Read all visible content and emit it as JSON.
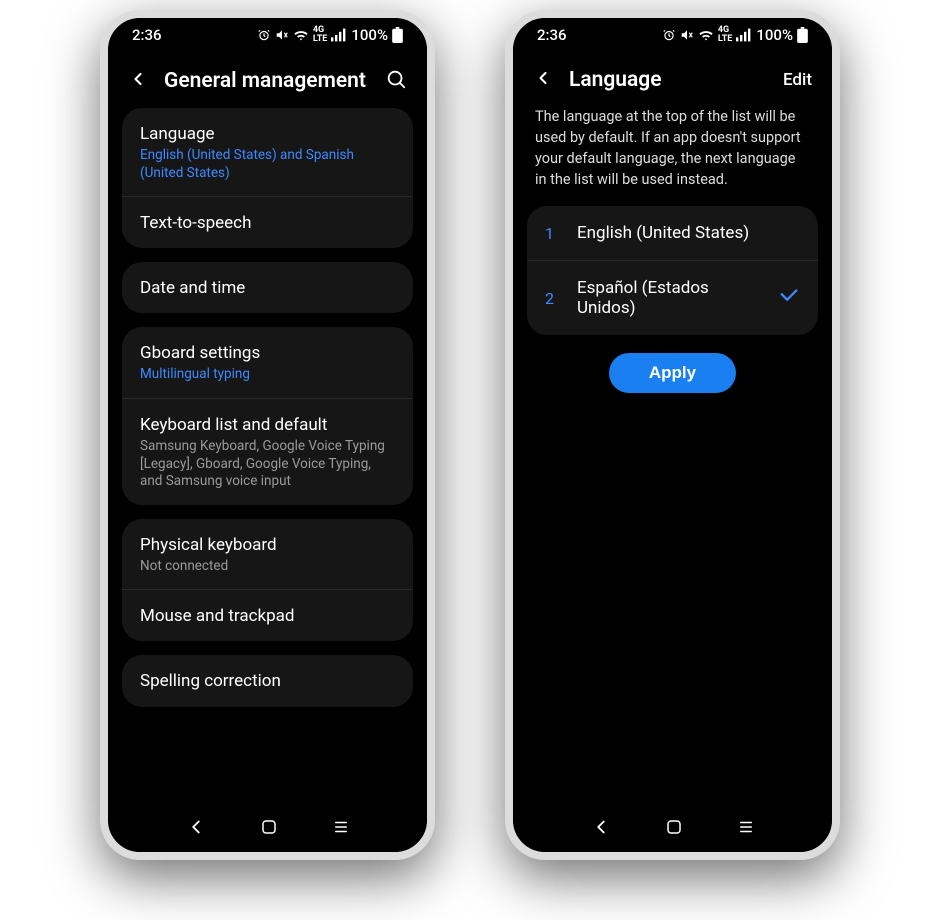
{
  "status": {
    "time": "2:36",
    "battery": "100%"
  },
  "phone1": {
    "title": "General management",
    "groups": [
      {
        "rows": [
          {
            "label": "Language",
            "sub": "English (United States) and Spanish (United States)",
            "accent": true
          },
          {
            "label": "Text-to-speech"
          }
        ]
      },
      {
        "rows": [
          {
            "label": "Date and time"
          }
        ]
      },
      {
        "rows": [
          {
            "label": "Gboard settings",
            "sub": "Multilingual typing",
            "accent": true
          },
          {
            "label": "Keyboard list and default",
            "sub": "Samsung Keyboard, Google Voice Typing [Legacy], Gboard, Google Voice Typing, and Samsung voice input"
          }
        ]
      },
      {
        "rows": [
          {
            "label": "Physical keyboard",
            "sub": "Not connected"
          },
          {
            "label": "Mouse and trackpad"
          }
        ]
      },
      {
        "rows": [
          {
            "label": "Spelling correction"
          }
        ]
      }
    ]
  },
  "phone2": {
    "title": "Language",
    "edit": "Edit",
    "help": "The language at the top of the list will be used by default. If an app doesn't support your default language, the next language in the list will be used instead.",
    "langs": [
      {
        "num": "1",
        "label": "English (United States)",
        "check": false
      },
      {
        "num": "2",
        "label": "Español (Estados Unidos)",
        "check": true
      }
    ],
    "apply": "Apply"
  }
}
